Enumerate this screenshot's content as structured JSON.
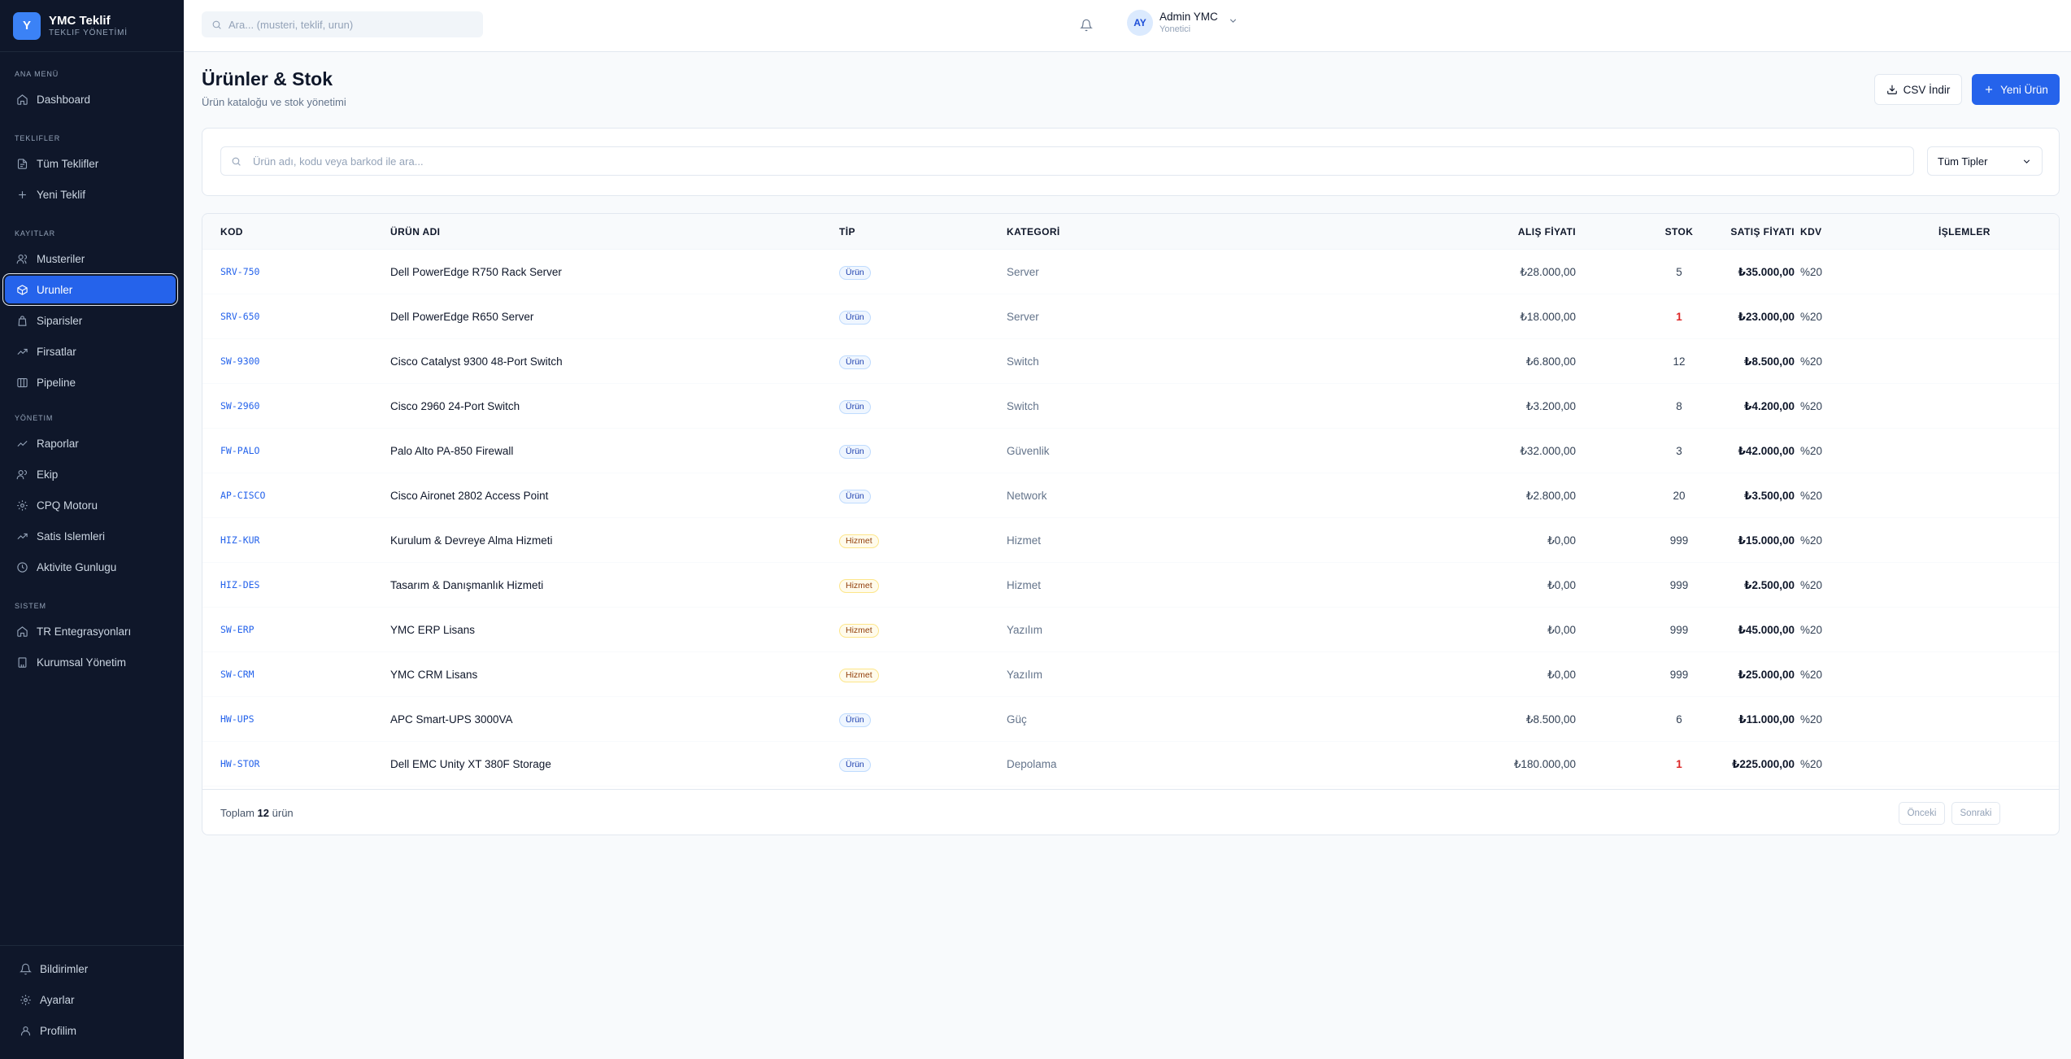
{
  "brand": {
    "logo": "Y",
    "title": "YMC Teklif",
    "subtitle": "TEKLIF YÖNETİMİ"
  },
  "sidebar": {
    "sections": [
      {
        "title": "ANA MENÜ",
        "items": [
          {
            "label": "Dashboard",
            "icon": "home-icon"
          }
        ]
      },
      {
        "title": "TEKLIFLER",
        "items": [
          {
            "label": "Tüm Teklifler",
            "icon": "file-icon"
          },
          {
            "label": "Yeni Teklif",
            "icon": "plus-icon"
          }
        ]
      },
      {
        "title": "KAYITLAR",
        "items": [
          {
            "label": "Musteriler",
            "icon": "users-icon"
          },
          {
            "label": "Urunler",
            "icon": "box-icon",
            "active": true
          },
          {
            "label": "Siparisler",
            "icon": "bag-icon"
          },
          {
            "label": "Firsatlar",
            "icon": "trend-icon"
          },
          {
            "label": "Pipeline",
            "icon": "columns-icon"
          }
        ]
      },
      {
        "title": "YÖNETIM",
        "items": [
          {
            "label": "Raporlar",
            "icon": "chart-icon"
          },
          {
            "label": "Ekip",
            "icon": "team-icon"
          },
          {
            "label": "CPQ Motoru",
            "icon": "gear-icon"
          },
          {
            "label": "Satis Islemleri",
            "icon": "trend-icon"
          },
          {
            "label": "Aktivite Gunlugu",
            "icon": "clock-icon"
          }
        ]
      },
      {
        "title": "SISTEM",
        "items": [
          {
            "label": "TR Entegrasyonları",
            "icon": "home-icon"
          },
          {
            "label": "Kurumsal Yönetim",
            "icon": "building-icon"
          }
        ]
      }
    ],
    "bottom": [
      {
        "label": "Bildirimler",
        "icon": "bell-icon"
      },
      {
        "label": "Ayarlar",
        "icon": "gear-icon"
      },
      {
        "label": "Profilim",
        "icon": "user-icon"
      }
    ]
  },
  "topbar": {
    "search_placeholder": "Ara... (musteri, teklif, urun)",
    "user": {
      "initials": "AY",
      "name": "Admin YMC",
      "role": "Yonetici"
    }
  },
  "page": {
    "title": "Ürünler & Stok",
    "subtitle": "Ürün kataloğu ve stok yönetimi",
    "csv_button": "CSV İndir",
    "new_button": "Yeni Ürün"
  },
  "filters": {
    "search_placeholder": "Ürün adı, kodu veya barkod ile ara...",
    "type_select": "Tüm Tipler"
  },
  "table": {
    "columns": [
      "KOD",
      "ÜRÜN ADI",
      "TİP",
      "KATEGORİ",
      "ALIŞ FİYATI",
      "SATIŞ FİYATI",
      "STOK",
      "KDV",
      "İŞLEMLER"
    ],
    "rows": [
      {
        "code": "SRV-750",
        "name": "Dell PowerEdge R750 Rack Server",
        "type": "Ürün",
        "category": "Server",
        "buy": "₺28.000,00",
        "sell": "₺35.000,00",
        "stock": "5",
        "low": false,
        "kdv": "%20"
      },
      {
        "code": "SRV-650",
        "name": "Dell PowerEdge R650 Server",
        "type": "Ürün",
        "category": "Server",
        "buy": "₺18.000,00",
        "sell": "₺23.000,00",
        "stock": "1",
        "low": true,
        "kdv": "%20"
      },
      {
        "code": "SW-9300",
        "name": "Cisco Catalyst 9300 48-Port Switch",
        "type": "Ürün",
        "category": "Switch",
        "buy": "₺6.800,00",
        "sell": "₺8.500,00",
        "stock": "12",
        "low": false,
        "kdv": "%20"
      },
      {
        "code": "SW-2960",
        "name": "Cisco 2960 24-Port Switch",
        "type": "Ürün",
        "category": "Switch",
        "buy": "₺3.200,00",
        "sell": "₺4.200,00",
        "stock": "8",
        "low": false,
        "kdv": "%20"
      },
      {
        "code": "FW-PALO",
        "name": "Palo Alto PA-850 Firewall",
        "type": "Ürün",
        "category": "Güvenlik",
        "buy": "₺32.000,00",
        "sell": "₺42.000,00",
        "stock": "3",
        "low": false,
        "kdv": "%20"
      },
      {
        "code": "AP-CISCO",
        "name": "Cisco Aironet 2802 Access Point",
        "type": "Ürün",
        "category": "Network",
        "buy": "₺2.800,00",
        "sell": "₺3.500,00",
        "stock": "20",
        "low": false,
        "kdv": "%20"
      },
      {
        "code": "HIZ-KUR",
        "name": "Kurulum & Devreye Alma Hizmeti",
        "type": "Hizmet",
        "category": "Hizmet",
        "buy": "₺0,00",
        "sell": "₺15.000,00",
        "stock": "999",
        "low": false,
        "kdv": "%20"
      },
      {
        "code": "HIZ-DES",
        "name": "Tasarım & Danışmanlık Hizmeti",
        "type": "Hizmet",
        "category": "Hizmet",
        "buy": "₺0,00",
        "sell": "₺2.500,00",
        "stock": "999",
        "low": false,
        "kdv": "%20"
      },
      {
        "code": "SW-ERP",
        "name": "YMC ERP Lisans",
        "type": "Hizmet",
        "category": "Yazılım",
        "buy": "₺0,00",
        "sell": "₺45.000,00",
        "stock": "999",
        "low": false,
        "kdv": "%20"
      },
      {
        "code": "SW-CRM",
        "name": "YMC CRM Lisans",
        "type": "Hizmet",
        "category": "Yazılım",
        "buy": "₺0,00",
        "sell": "₺25.000,00",
        "stock": "999",
        "low": false,
        "kdv": "%20"
      },
      {
        "code": "HW-UPS",
        "name": "APC Smart-UPS 3000VA",
        "type": "Ürün",
        "category": "Güç",
        "buy": "₺8.500,00",
        "sell": "₺11.000,00",
        "stock": "6",
        "low": false,
        "kdv": "%20"
      },
      {
        "code": "HW-STOR",
        "name": "Dell EMC Unity XT 380F Storage",
        "type": "Ürün",
        "category": "Depolama",
        "buy": "₺180.000,00",
        "sell": "₺225.000,00",
        "stock": "1",
        "low": true,
        "kdv": "%20"
      }
    ],
    "footer": {
      "prefix": "Toplam",
      "count": "12",
      "suffix": "ürün",
      "prev": "Önceki",
      "next": "Sonraki"
    }
  }
}
